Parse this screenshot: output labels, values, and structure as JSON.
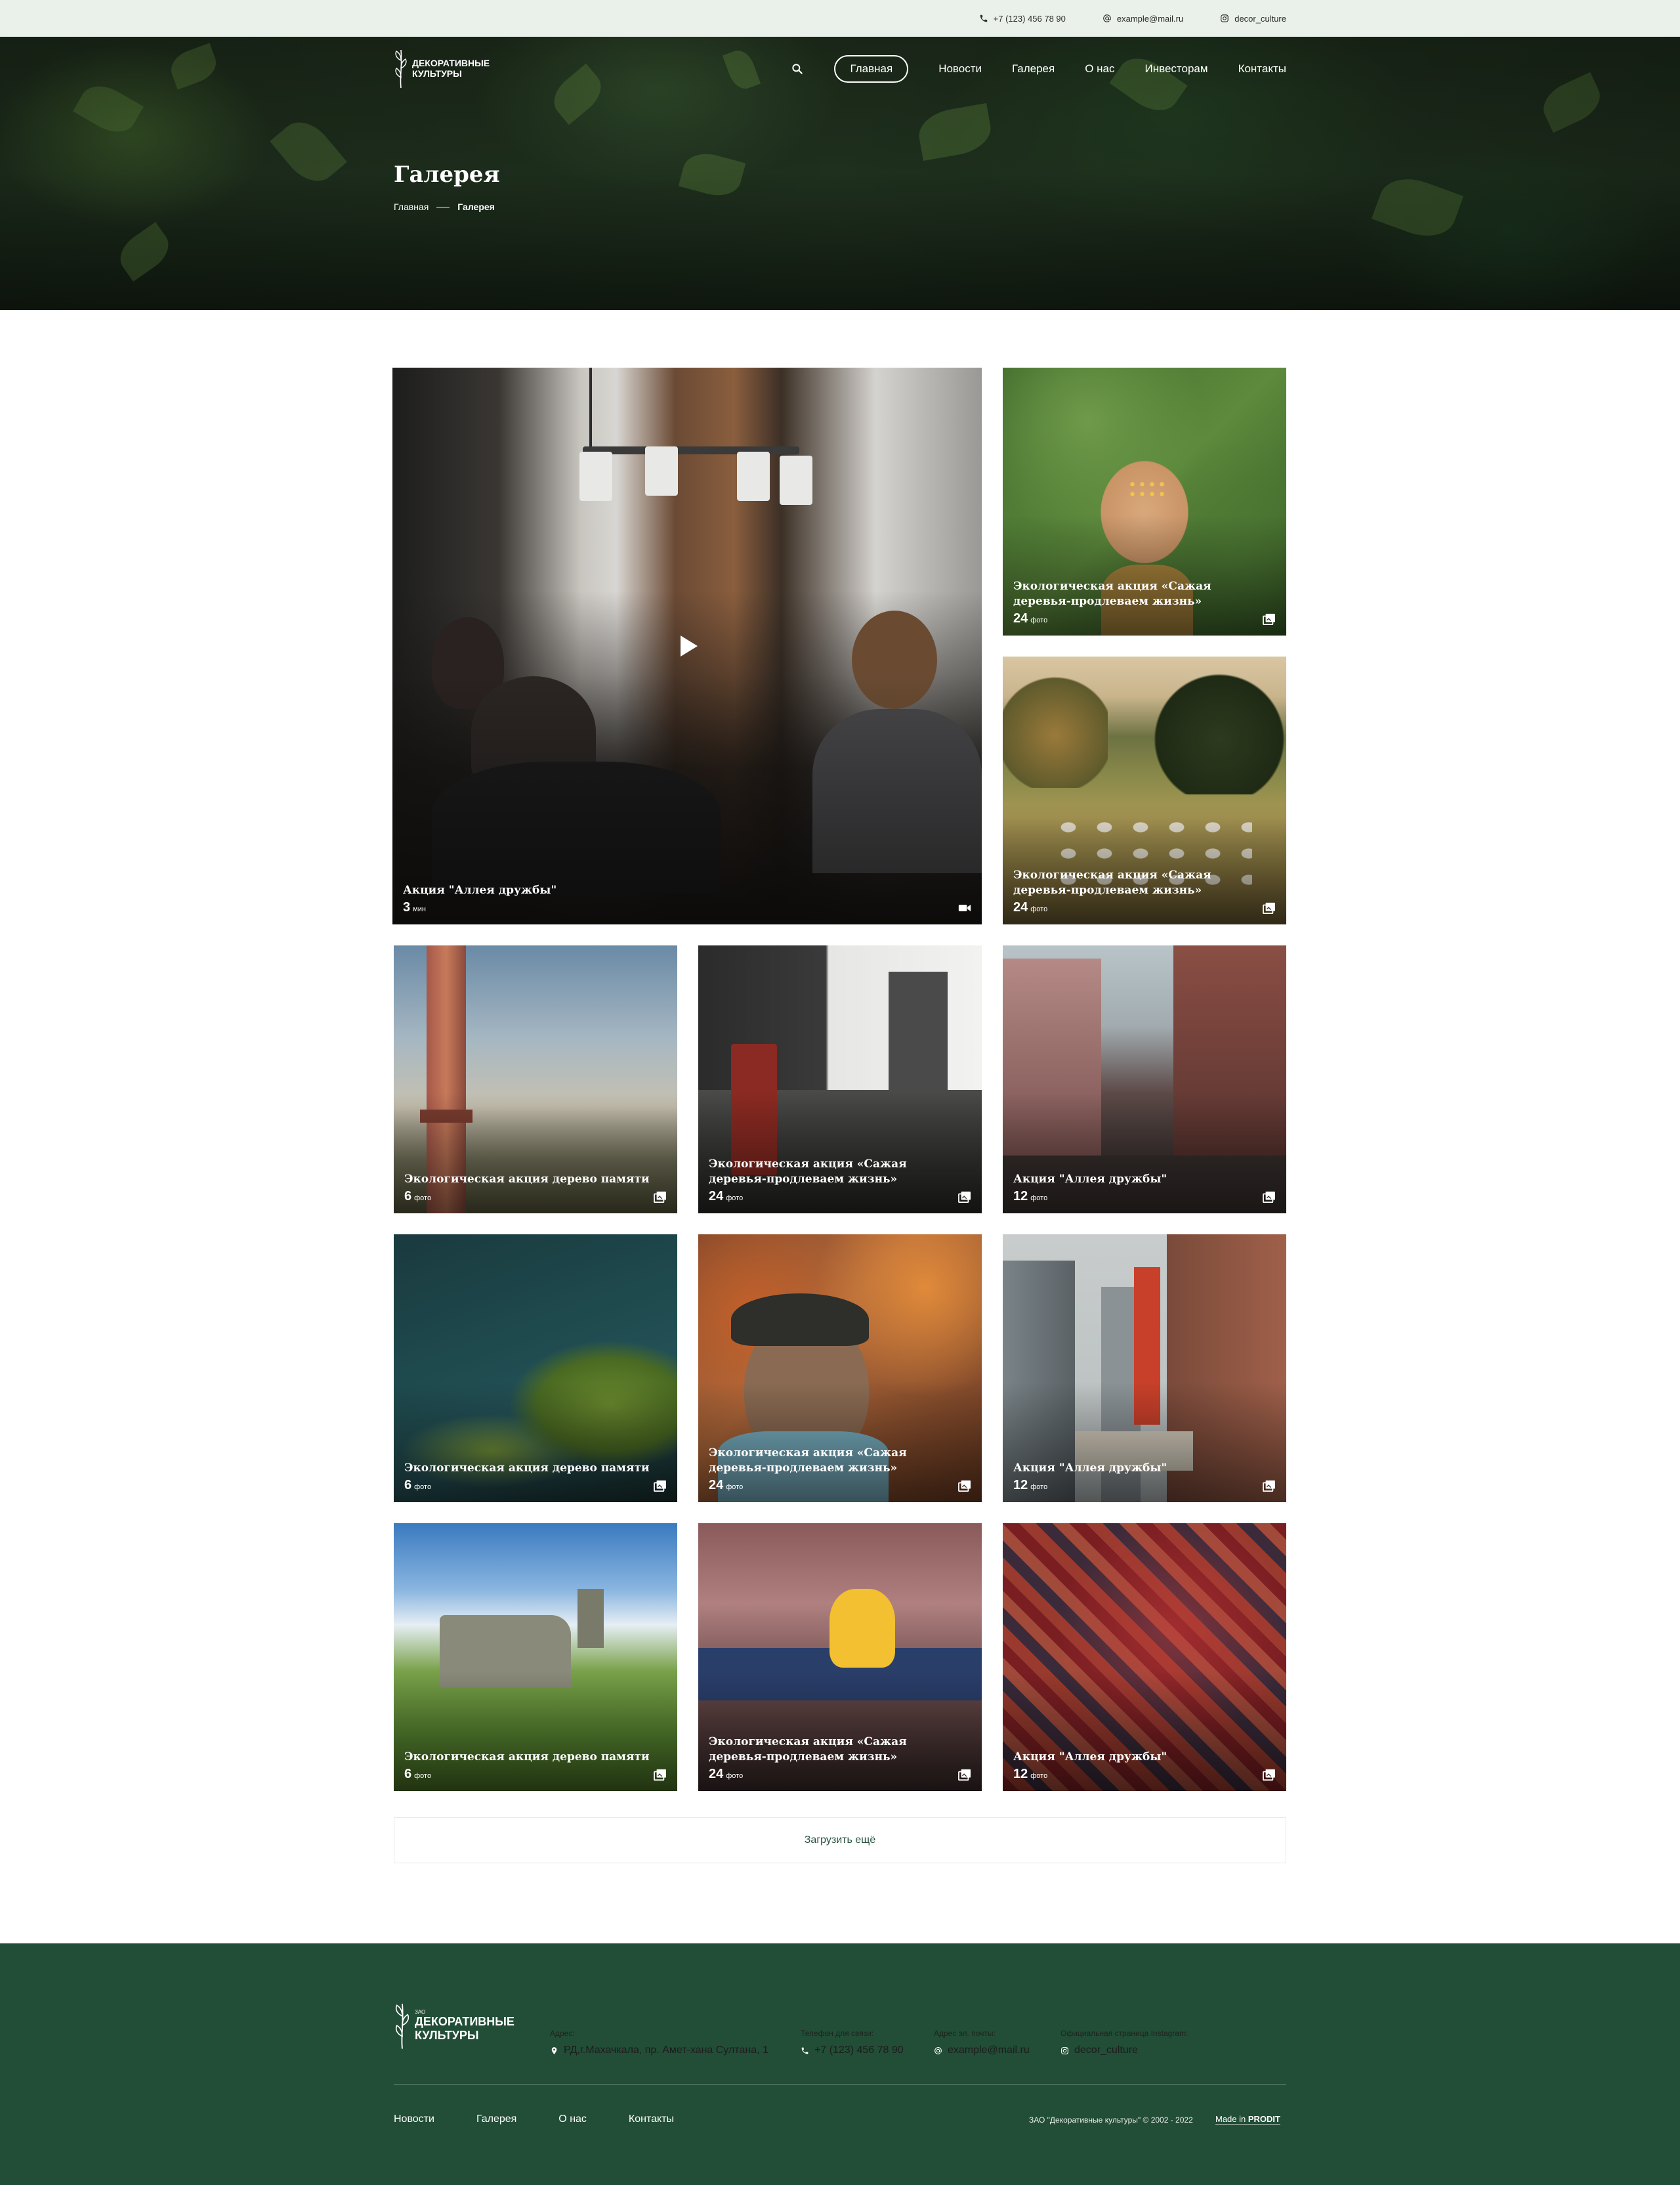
{
  "topbar": {
    "phone": "+7 (123) 456 78 90",
    "email": "example@mail.ru",
    "instagram": "decor_culture"
  },
  "logo": {
    "line1": "ДЕКОРАТИВНЫЕ",
    "line2": "КУЛЬТУРЫ",
    "zao": "ЗАО"
  },
  "nav": {
    "items": [
      "Главная",
      "Новости",
      "Галерея",
      "О нас",
      "Инвесторам",
      "Контакты"
    ],
    "active_index": 0
  },
  "page": {
    "title": "Галерея",
    "breadcrumb": [
      "Главная",
      "Галерея"
    ]
  },
  "gallery": [
    {
      "title": "Акция \"Аллея дружбы\"",
      "count": "3",
      "unit": "мин",
      "type": "video"
    },
    {
      "title": "Экологическая акция «Сажая деревья-продлеваем жизнь»",
      "count": "24",
      "unit": "фото",
      "type": "photo"
    },
    {
      "title": "Экологическая акция «Сажая деревья-продлеваем жизнь»",
      "count": "24",
      "unit": "фото",
      "type": "photo"
    },
    {
      "title": "Экологическая акция дерево памяти",
      "count": "6",
      "unit": "фото",
      "type": "photo"
    },
    {
      "title": "Экологическая акция «Сажая деревья-продлеваем жизнь»",
      "count": "24",
      "unit": "фото",
      "type": "photo"
    },
    {
      "title": "Акция \"Аллея дружбы\"",
      "count": "12",
      "unit": "фото",
      "type": "photo"
    },
    {
      "title": "Экологическая акция дерево памяти",
      "count": "6",
      "unit": "фото",
      "type": "photo"
    },
    {
      "title": "Экологическая акция «Сажая деревья-продлеваем жизнь»",
      "count": "24",
      "unit": "фото",
      "type": "photo"
    },
    {
      "title": "Акция \"Аллея дружбы\"",
      "count": "12",
      "unit": "фото",
      "type": "photo"
    },
    {
      "title": "Экологическая акция дерево памяти",
      "count": "6",
      "unit": "фото",
      "type": "photo"
    },
    {
      "title": "Экологическая акция «Сажая деревья-продлеваем жизнь»",
      "count": "24",
      "unit": "фото",
      "type": "photo"
    },
    {
      "title": "Акция \"Аллея дружбы\"",
      "count": "12",
      "unit": "фото",
      "type": "photo"
    }
  ],
  "load_more": "Загрузить ещё",
  "footer": {
    "address_label": "Адрес:",
    "address": "РД,г.Махачкала, пр. Амет-хана Султана, 1",
    "phone_label": "Телефон для связи:",
    "phone": "+7 (123) 456 78 90",
    "email_label": "Адрес эл. почты:",
    "email": "example@mail.ru",
    "instagram_label": "Официальная страница Instagram:",
    "instagram": "decor_culture",
    "nav": [
      "Новости",
      "Галерея",
      "О нас",
      "Контакты"
    ],
    "copyright": "ЗАО \"Декоративные культуры\" © 2002 - 2022",
    "made_in": "Made in",
    "made_by": "PRODIT"
  },
  "colors": {
    "topbar_bg": "#eaf1ea",
    "footer_bg": "#224d36",
    "accent_text": "#24503a"
  }
}
